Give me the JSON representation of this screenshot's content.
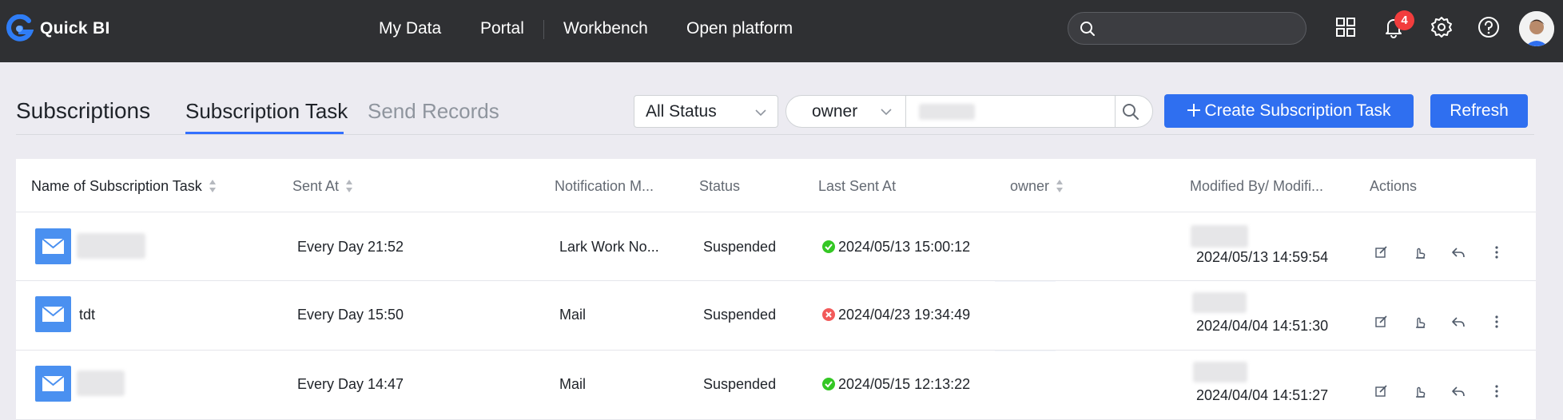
{
  "app": {
    "name": "Quick BI"
  },
  "nav": {
    "items": [
      "My Data",
      "Portal",
      "Workbench",
      "Open platform"
    ]
  },
  "topbar": {
    "search_placeholder": "",
    "notification_count": "4"
  },
  "tabs": [
    "Subscriptions",
    "Subscription Task",
    "Send Records"
  ],
  "filters": {
    "status": "All Status",
    "owner_field": "owner"
  },
  "buttons": {
    "create": "Create Subscription Task",
    "refresh": "Refresh"
  },
  "table": {
    "columns": [
      "Name of Subscription Task",
      "Sent At",
      "Notification M...",
      "Status",
      "Last Sent At",
      "owner",
      "Modified By/ Modifi...",
      "Actions"
    ],
    "rows": [
      {
        "name": "",
        "sent_at": "Every Day 21:52",
        "notification": "Lark Work No...",
        "status": "Suspended",
        "last_sent": "2024/05/13 15:00:12",
        "last_sent_state": "success",
        "modified_at": "2024/05/13 14:59:54"
      },
      {
        "name": "tdt",
        "sent_at": "Every Day 15:50",
        "notification": "Mail",
        "status": "Suspended",
        "last_sent": "2024/04/23 19:34:49",
        "last_sent_state": "error",
        "modified_at": "2024/04/04 14:51:30"
      },
      {
        "name": "",
        "sent_at": "Every Day 14:47",
        "notification": "Mail",
        "status": "Suspended",
        "last_sent": "2024/05/15 12:13:22",
        "last_sent_state": "success",
        "modified_at": "2024/04/04 14:51:27"
      }
    ]
  },
  "colors": {
    "accent": "#2f6ff0",
    "topbar": "#2f3033",
    "success": "#34c724",
    "error": "#f25a5a",
    "badge": "#f23d3d"
  },
  "icons": [
    "search-icon",
    "apps-grid-icon",
    "bell-icon",
    "gear-icon",
    "help-icon",
    "mail-icon",
    "edit-icon",
    "push-icon",
    "share-icon",
    "more-icon",
    "plus-icon",
    "chevron-down-icon",
    "sort-icon"
  ]
}
